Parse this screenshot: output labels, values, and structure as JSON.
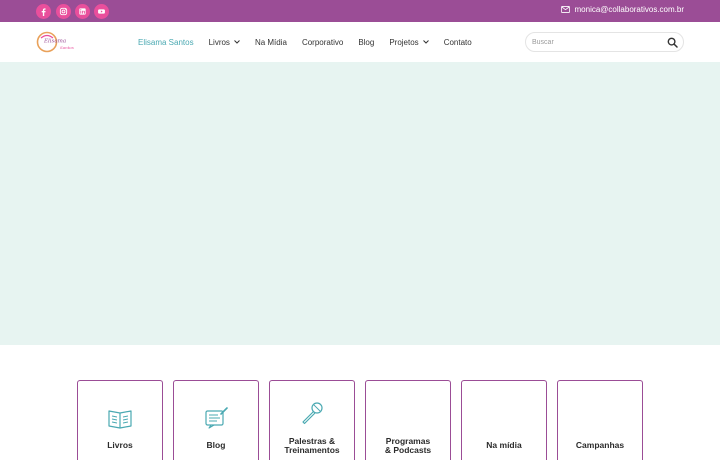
{
  "topbar": {
    "social": [
      {
        "icon": "facebook-icon"
      },
      {
        "icon": "instagram-icon"
      },
      {
        "icon": "linkedin-icon"
      },
      {
        "icon": "youtube-icon"
      }
    ],
    "email": "monica@collaborativos.com.br"
  },
  "header": {
    "logo_text": "Elisama Santos",
    "nav": [
      {
        "label": "Elisama Santos",
        "active": true
      },
      {
        "label": "Livros",
        "dropdown": true
      },
      {
        "label": "Na Mídia"
      },
      {
        "label": "Corporativo"
      },
      {
        "label": "Blog"
      },
      {
        "label": "Projetos",
        "dropdown": true
      },
      {
        "label": "Contato"
      }
    ],
    "search": {
      "placeholder": "Buscar"
    }
  },
  "cards": [
    {
      "line1": "Livros",
      "line2": "",
      "icon": "book-icon"
    },
    {
      "line1": "Blog",
      "line2": "",
      "icon": "blog-icon"
    },
    {
      "line1": "Palestras &",
      "line2": "Treinamentos",
      "icon": "microphone-icon"
    },
    {
      "line1": "Programas",
      "line2": "& Podcasts",
      "icon": ""
    },
    {
      "line1": "Na mídia",
      "line2": "",
      "icon": ""
    },
    {
      "line1": "Campanhas",
      "line2": "",
      "icon": ""
    }
  ],
  "colors": {
    "topbar": "#9b4d96",
    "social": "#e94f9c",
    "accent": "#4aa9b2",
    "hero": "#e7f4f1",
    "card_border": "#9b4d96"
  }
}
